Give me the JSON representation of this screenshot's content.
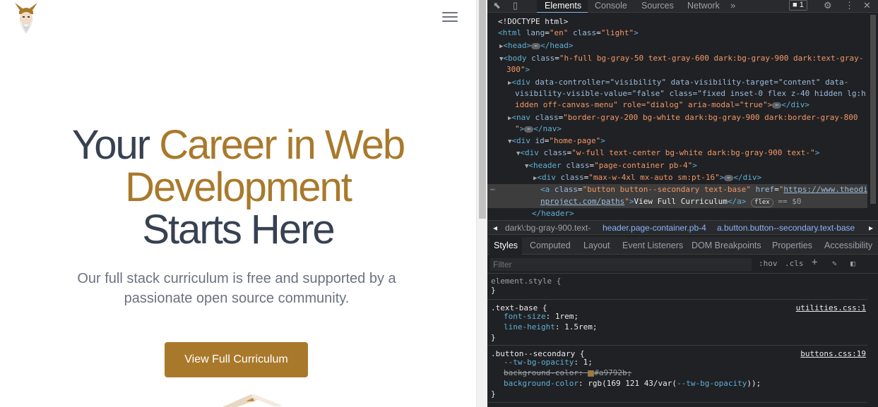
{
  "page": {
    "hero_title_dark1": "Your ",
    "hero_title_accent": "Career in Web Development",
    "hero_title_dark2": "Starts Here",
    "hero_subtitle": "Our full stack curriculum is free and supported by a passionate open source community.",
    "cta_label": "View Full Curriculum",
    "accent_color": "#a9792b"
  },
  "devtools": {
    "tabs": [
      "Elements",
      "Console",
      "Sources",
      "Network"
    ],
    "active_tab": "Elements",
    "more_tabs_icon": "chevron-double-right-icon",
    "issues_count": "1",
    "dom": {
      "doctype": "<!DOCTYPE html>",
      "html_open": {
        "tag": "html",
        "attrs": [
          [
            "lang",
            "en"
          ],
          [
            "class",
            "light"
          ]
        ]
      },
      "head": "head",
      "body_class_1": "h-full bg-gray-50 text-gray-600 dark:bg-gray-900 dark:text-gray-",
      "body_class_2": "300",
      "div1_part1": "data-controller=\"visibility\" data-visibility-target=\"content\" data-",
      "div1_part2": "visibility-visible-value=\"false\" class=\"fixed inset-0 flex z-40 hidden lg:h",
      "div1_part3": "idden off-canvas-menu\" role=\"dialog\" aria-modal=\"true\">",
      "nav_class_1": "border-gray-200 bg-white dark:bg-gray-900 dark:border-gray-800",
      "home_id": "home-page",
      "div2_class": "w-full text-center bg-white dark:bg-gray-900 text-",
      "header_class": "page-container pb-4",
      "div3_class": "max-w-4xl mx-auto sm:pt-16",
      "a_class": "button button--secondary text-base",
      "a_href_1": "https://www.theodi",
      "a_href_2": "nproject.com/paths",
      "a_text": "View Full Curriculum",
      "flex_badge": "flex",
      "eq_dollar": "== $0",
      "header_close": "</header>"
    },
    "breadcrumbs": [
      "dark\\:bg-gray-900.text-",
      "header.page-container.pb-4",
      "a.button.button--secondary.text-base"
    ],
    "subtabs": [
      "Styles",
      "Computed",
      "Layout",
      "Event Listeners",
      "DOM Breakpoints",
      "Properties",
      "Accessibility"
    ],
    "active_subtab": "Styles",
    "filter_placeholder": "Filter",
    "hov_label": ":hov",
    "cls_label": ".cls",
    "styles": {
      "element_style": "element.style {",
      "close_brace": "}",
      "text_base_selector": ".text-base {",
      "text_base_source": "utilities.css:1",
      "text_base_props": [
        [
          "font-size",
          "1rem"
        ],
        [
          "line-height",
          "1.5rem"
        ]
      ],
      "button_selector": ".button--secondary {",
      "button_source": "buttons.css:19",
      "tw_opacity_prop": "--tw-bg-opacity",
      "tw_opacity_val": "1",
      "bg_color_prop_struck": "background-color",
      "bg_color_val_struck": "#a9792b",
      "bg_color_prop": "background-color",
      "bg_color_val_prefix": "rgb(169 121 43/var(",
      "bg_color_var": "--tw-bg-opacity",
      "bg_color_val_suffix": "));",
      "swatch_color": "#a9792b"
    }
  }
}
